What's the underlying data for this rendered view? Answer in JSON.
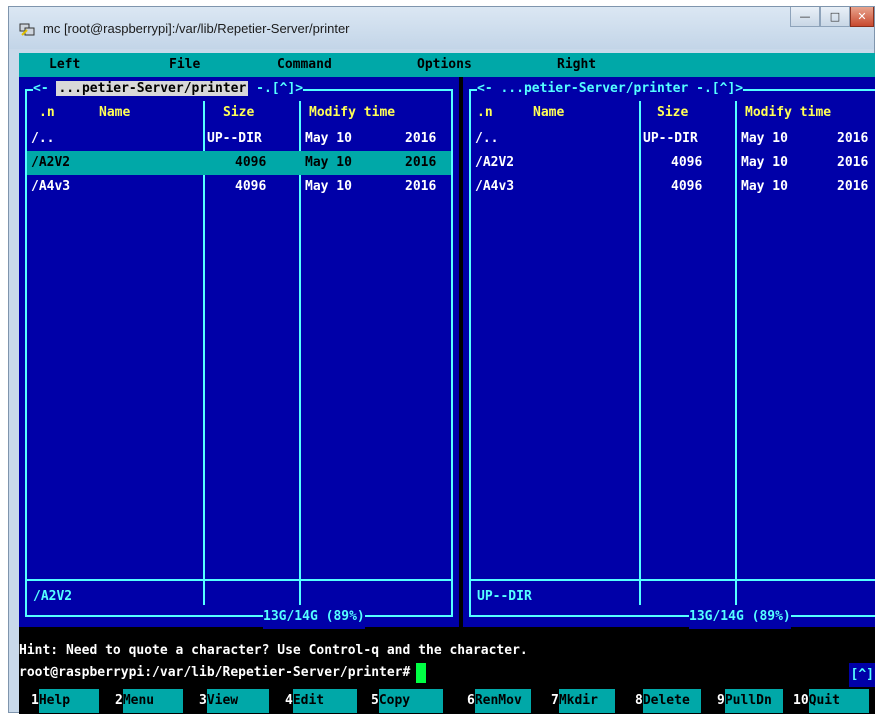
{
  "window": {
    "title": "mc [root@raspberrypi]:/var/lib/Repetier-Server/printer",
    "controls": [
      "minimize",
      "maximize",
      "close"
    ]
  },
  "menubar": [
    "Left",
    "File",
    "Command",
    "Options",
    "Right"
  ],
  "left_panel": {
    "path_prefix": "<-",
    "path": "...petier-Server/printer",
    "path_suffix": "-.[^]>",
    "headers": [
      ".n",
      "Name",
      "Size",
      "Modify time"
    ],
    "rows": [
      {
        "name": "/..",
        "size": "UP--DIR",
        "date": "May 10",
        "year": "2016"
      },
      {
        "name": "/A2V2",
        "size": "4096",
        "date": "May 10",
        "year": "2016",
        "selected": true
      },
      {
        "name": "/A4v3",
        "size": "4096",
        "date": "May 10",
        "year": "2016"
      }
    ],
    "mini_status": "/A2V2",
    "free_space": "13G/14G (89%)"
  },
  "right_panel": {
    "path_prefix": "<-",
    "path": "...petier-Server/printer",
    "path_suffix": "-.[^]>",
    "headers": [
      ".n",
      "Name",
      "Size",
      "Modify time"
    ],
    "rows": [
      {
        "name": "/..",
        "size": "UP--DIR",
        "date": "May 10",
        "year": "2016"
      },
      {
        "name": "/A2V2",
        "size": "4096",
        "date": "May 10",
        "year": "2016"
      },
      {
        "name": "/A4v3",
        "size": "4096",
        "date": "May 10",
        "year": "2016"
      }
    ],
    "mini_status": "UP--DIR",
    "free_space": "13G/14G (89%)"
  },
  "hint": "Hint: Need to quote a character?  Use Control-q and the character.",
  "prompt": "root@raspberrypi:/var/lib/Repetier-Server/printer#",
  "corner_badge": "[^]",
  "fkeys": [
    {
      "num": "1",
      "label": "Help"
    },
    {
      "num": "2",
      "label": "Menu"
    },
    {
      "num": "3",
      "label": "View"
    },
    {
      "num": "4",
      "label": "Edit"
    },
    {
      "num": "5",
      "label": "Copy"
    },
    {
      "num": "6",
      "label": "RenMov"
    },
    {
      "num": "7",
      "label": "Mkdir"
    },
    {
      "num": "8",
      "label": "Delete"
    },
    {
      "num": "9",
      "label": "PullDn"
    },
    {
      "num": "10",
      "label": "Quit"
    }
  ],
  "colors": {
    "panel_bg": "#0000a8",
    "cyan": "#00a8a8",
    "border": "#55ffff",
    "header": "#ffff55"
  }
}
